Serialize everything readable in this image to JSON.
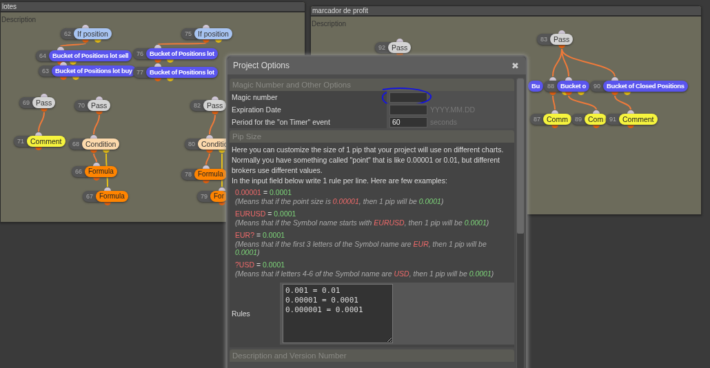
{
  "panels": [
    {
      "title": "lotes",
      "description": "Description",
      "nodes": [
        {
          "id": "62",
          "label": "If position",
          "kind": "if"
        },
        {
          "id": "75",
          "label": "If position",
          "kind": "if"
        },
        {
          "id": "64",
          "label": "Bucket of Positions lot sell",
          "kind": "bucket"
        },
        {
          "id": "76",
          "label": "Bucket of Positions lot",
          "kind": "bucket"
        },
        {
          "id": "63",
          "label": "Bucket of Positions lot buy",
          "kind": "bucket"
        },
        {
          "id": "77",
          "label": "Bucket of Positions lot",
          "kind": "bucket"
        },
        {
          "id": "69",
          "label": "Pass",
          "kind": "pass"
        },
        {
          "id": "70",
          "label": "Pass",
          "kind": "pass"
        },
        {
          "id": "82",
          "label": "Pass",
          "kind": "pass"
        },
        {
          "id": "71",
          "label": "Comment",
          "kind": "comment"
        },
        {
          "id": "68",
          "label": "Condition",
          "kind": "condition"
        },
        {
          "id": "80",
          "label": "Conditio",
          "kind": "condition"
        },
        {
          "id": "66",
          "label": "Formula",
          "kind": "formula"
        },
        {
          "id": "78",
          "label": "Formula",
          "kind": "formula"
        },
        {
          "id": "67",
          "label": "Formula",
          "kind": "formula"
        },
        {
          "id": "79",
          "label": "For",
          "kind": "formula"
        }
      ]
    },
    {
      "title": "marcador de profit",
      "description": "Description",
      "nodes": [
        {
          "id": "92",
          "label": "Pass",
          "kind": "pass"
        },
        {
          "id": "83",
          "label": "Pass",
          "kind": "pass"
        },
        {
          "label": "Bu",
          "kind": "bucket"
        },
        {
          "id": "88",
          "label": "Bucket o",
          "kind": "bucket"
        },
        {
          "id": "90",
          "label": "Bucket of Closed Positions",
          "kind": "bucket"
        },
        {
          "id": "87",
          "label": "Comm",
          "kind": "comment"
        },
        {
          "id": "89",
          "label": "Com",
          "kind": "comment"
        },
        {
          "id": "91",
          "label": "Comment",
          "kind": "comment"
        }
      ]
    }
  ],
  "dialog": {
    "title": "Project Options",
    "close": "✖",
    "sections": [
      {
        "kind": "fields",
        "title": "Magic Number and Other Options",
        "fields": [
          {
            "label": "Magic number",
            "annotated": true
          },
          {
            "label": "Expiration Date",
            "unit": "YYYY.MM.DD",
            "annotated": false
          },
          {
            "label": "Period for the \"on Timer\" event",
            "value": "60",
            "unit": "seconds",
            "annotated": false
          }
        ]
      },
      {
        "kind": "pip",
        "title": "Pip Size",
        "intro": [
          "Here you can customize the size of 1 pip that your project will use on different charts.",
          "Normally you have something called \"point\" that is like 0.00001 or 0.01, but different brokers use different values.",
          "In the input field below write 1 rule per line. Here are few examples:"
        ],
        "examples": [
          {
            "rule": [
              {
                "text": "0.00001",
                "kind": "key"
              },
              {
                "text": " = ",
                "kind": "plain"
              },
              {
                "text": "0.0001",
                "kind": "value"
              }
            ],
            "note": [
              {
                "text": "(Means that if the point size is ",
                "kind": "plain"
              },
              {
                "text": "0.00001",
                "kind": "key"
              },
              {
                "text": ", then 1 pip will be ",
                "kind": "plain"
              },
              {
                "text": "0.0001",
                "kind": "value"
              },
              {
                "text": ")",
                "kind": "plain"
              }
            ]
          },
          {
            "rule": [
              {
                "text": "EURUSD",
                "kind": "key"
              },
              {
                "text": " = ",
                "kind": "plain"
              },
              {
                "text": "0.0001",
                "kind": "value"
              }
            ],
            "note": [
              {
                "text": "(Means that if the Symbol name starts with ",
                "kind": "plain"
              },
              {
                "text": "EURUSD",
                "kind": "key"
              },
              {
                "text": ", then 1 pip will be ",
                "kind": "plain"
              },
              {
                "text": "0.0001",
                "kind": "value"
              },
              {
                "text": ")",
                "kind": "plain"
              }
            ]
          },
          {
            "rule": [
              {
                "text": "EUR?",
                "kind": "key"
              },
              {
                "text": " = ",
                "kind": "plain"
              },
              {
                "text": "0.0001",
                "kind": "value"
              }
            ],
            "note": [
              {
                "text": "(Means that if the first 3 letters of the Symbol name are ",
                "kind": "plain"
              },
              {
                "text": "EUR",
                "kind": "key"
              },
              {
                "text": ", then 1 pip will be ",
                "kind": "plain"
              },
              {
                "text": "0.0001",
                "kind": "value"
              },
              {
                "text": ")",
                "kind": "plain"
              }
            ]
          },
          {
            "rule": [
              {
                "text": "?USD",
                "kind": "key"
              },
              {
                "text": " = ",
                "kind": "plain"
              },
              {
                "text": "0.0001",
                "kind": "value"
              }
            ],
            "note": [
              {
                "text": "(Means that if letters 4-6 of the Symbol name are ",
                "kind": "plain"
              },
              {
                "text": "USD",
                "kind": "key"
              },
              {
                "text": ", then 1 pip will be ",
                "kind": "plain"
              },
              {
                "text": "0.0001",
                "kind": "value"
              },
              {
                "text": ")",
                "kind": "plain"
              }
            ]
          }
        ],
        "rules_label": "Rules",
        "rules": "0.001 = 0.01\n0.00001 = 0.0001\n0.000001 = 0.0001"
      },
      {
        "kind": "header",
        "title": "Description and Version Number"
      }
    ]
  }
}
